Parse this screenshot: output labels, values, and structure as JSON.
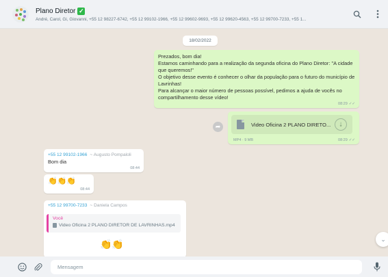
{
  "header": {
    "group_name": "Plano Diretor",
    "verified_glyph": "✓",
    "members": "André, Carol, Gi, Giovanni, +55 12 98227-6742, +55 12 99102-1966, +55 12 99602-9693, +55 12 99620-4563, +55 12 99700-7233, +55 1...",
    "icons": [
      "group-avatar",
      "search-icon",
      "menu-icon"
    ]
  },
  "chat": {
    "date_chip": "18/02/2022",
    "messages": [
      {
        "direction": "outgoing",
        "text": "Prezados, bom dia!\nEstamos caminhando para a realização da segunda oficina do Plano Diretor: \"A cidade que queremos!\"\nO objetivo desse evento é conhecer o olhar da população para o futuro do município de Lavrinhas!\nPara alcançar o maior número de pessoas possível, pedimos a ajuda de vocês no compartilhamento desse vídeo!",
        "time": "08:29",
        "ticks": "✓✓"
      },
      {
        "direction": "outgoing",
        "type": "file",
        "file_name": "Video Oficina 2 PLANO DIRETO...",
        "file_meta": "MP4 · 9 MB",
        "time": "08:29",
        "ticks": "✓✓"
      },
      {
        "direction": "incoming",
        "sender_number": "+55 12 99102-1966",
        "sender_name": "~ Augusto Pompaloli",
        "text": "Bom dia",
        "time": "08:44"
      },
      {
        "direction": "incoming",
        "text": "👏👏👏",
        "time": "08:44"
      },
      {
        "direction": "incoming",
        "sender_number": "+55 12 99700-7233",
        "sender_name": "~ Daniela Campos",
        "quote_author": "Você",
        "quote_text": "Video Oficina 2 PLANO DIRETOR DE LAVRINHAS.mp4",
        "text": "👏👏"
      }
    ]
  },
  "footer": {
    "placeholder": "Mensagem",
    "icons": [
      "emoji-icon",
      "attach-icon",
      "mic-icon"
    ]
  },
  "colors": {
    "outgoing_bubble": "#dcf8c6",
    "incoming_bubble": "#ffffff",
    "chat_background": "#ece5dd",
    "header_background": "#f0f2f5",
    "verified": "#2fb84a",
    "sender_number": "#35a2d4",
    "quote_accent": "#e542a3"
  }
}
